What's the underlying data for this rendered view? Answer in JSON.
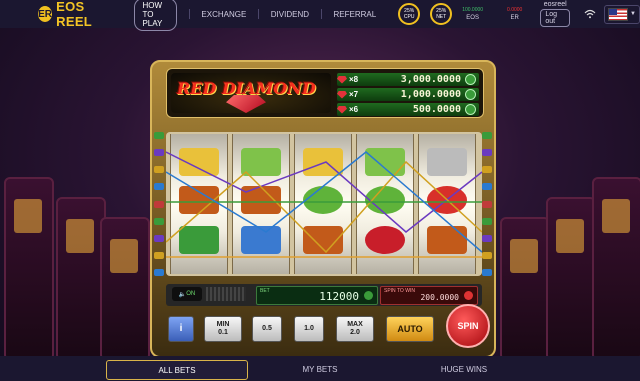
{
  "topbar": {
    "logo": "EOS REEL",
    "nav": {
      "how_to_play": "HOW TO PLAY",
      "exchange": "EXCHANGE",
      "dividend": "DIVIDEND",
      "referral": "REFERRAL"
    },
    "cpu": {
      "value": "25%",
      "label": "CPU"
    },
    "net": {
      "value": "25%",
      "label": "NET"
    },
    "eos_balance": {
      "amount": "100.0000",
      "unit": "EOS"
    },
    "er_balance": {
      "amount": "0.0000",
      "unit": "ER"
    },
    "user": {
      "name": "eosreel",
      "logout": "Log out"
    }
  },
  "machine": {
    "title": "RED DIAMOND",
    "paytable": [
      {
        "mult": "×8",
        "amount": "3,000.0000"
      },
      {
        "mult": "×7",
        "amount": "1,000.0000"
      },
      {
        "mult": "×6",
        "amount": "500.0000"
      }
    ],
    "sound": "ON",
    "bet_label": "BET",
    "bet_value": "112000",
    "win_label": "SPIN TO WIN",
    "win_value": "200.0000",
    "buttons": {
      "info": "i",
      "min_label": "MIN",
      "min_value": "0.1",
      "half": "0.5",
      "one": "1.0",
      "max_label": "MAX",
      "max_value": "2.0",
      "auto": "AUTO",
      "spin": "SPIN"
    }
  },
  "tabs": {
    "all_bets": "ALL BETS",
    "my_bets": "MY BETS",
    "huge_wins": "HUGE WINS"
  },
  "colors": {
    "accent": "#f3c425",
    "nav_bg": "#1b1730",
    "green": "#3fc06a",
    "red": "#e33333"
  }
}
